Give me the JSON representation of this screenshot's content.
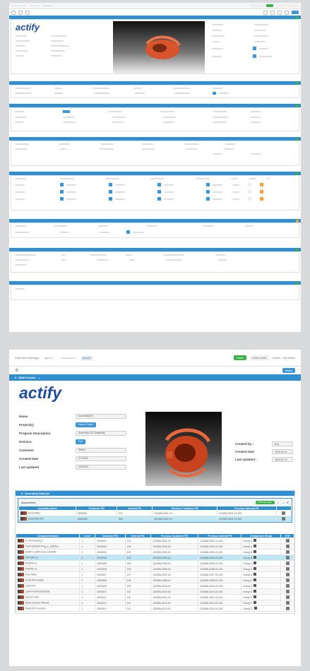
{
  "s1": {
    "tabs": [
      "",
      "",
      ""
    ],
    "header_pills": [
      "",
      "",
      ""
    ]
  },
  "s2": {
    "app_title": "Solid Item Manager",
    "tabs": [
      "Items",
      "Assembly List",
      "Draft"
    ],
    "top_right": {
      "green_btn": "Latest",
      "dropdown": "Select views",
      "user": "Admin · My tables"
    },
    "new_btn": "New",
    "banner_title": "SAM Version",
    "logo_text": "actify",
    "left_fields": [
      {
        "label": "Name",
        "value": "Assembly001"
      },
      {
        "label": "Project(s)",
        "value": "Demo Project",
        "style": "button"
      },
      {
        "label": "Program Description",
        "value": "Assembly 001 Assembly"
      },
      {
        "label": "Division",
        "value": "Part",
        "style": "button"
      },
      {
        "label": "Customer",
        "value": "Select"
      },
      {
        "label": "Created date",
        "value": "2/7/2023"
      },
      {
        "label": "Last updated",
        "value": "3/9/2023"
      }
    ],
    "right_fields": [
      {
        "label": "Created by :",
        "value": "Ken"
      },
      {
        "label": "Created date",
        "value": "2023-01-01"
      },
      {
        "label": "Last updated :",
        "value": "2023-01-01"
      }
    ],
    "assembly_panel_title": "Assembly Data (2)",
    "sub_title": "Assemblies",
    "sub_btn": "Add Assembly",
    "assembly_headers": [
      "Assembly Name",
      "Customer PN",
      "Internal PN",
      "Previous Customer PN",
      "Previous Internal PN",
      ""
    ],
    "assembly_rows": [
      {
        "name": "Assembly1",
        "cpn": "6500001",
        "ipn": "001",
        "pcpn": "123456-0001-22",
        "pipn": "123456-0001-22-001",
        "sel": false
      },
      {
        "name": "Assembly 001",
        "cpn": "6500002",
        "ipn": "002",
        "pcpn": "123456-0002-22",
        "pipn": "123456-0002-22-001",
        "sel": true
      }
    ],
    "component_headers": [
      "Component Name",
      "Level",
      "Customer PN",
      "Internal PN",
      "Previous Customer PN",
      "Previous Internal PN",
      "Component Group",
      "STR"
    ],
    "component_rows": [
      {
        "name": "E. Ink Sensing 1",
        "level": "1",
        "cpn": "2000001",
        "ipn": "101",
        "pcpn": "123456-2001-01",
        "pipn": "123456-2001-01-001",
        "group": "Group A",
        "sel": false
      },
      {
        "name": "Front (default Plug_1_2)(tube)",
        "level": "1",
        "cpn": "2000002",
        "ipn": "102",
        "pcpn": "123456-2002-01",
        "pipn": "123456-2002-01-001",
        "group": "Group A",
        "sel": false
      },
      {
        "name": "Shaft+1 (with Lever Default)",
        "level": "1",
        "cpn": "2000003",
        "ipn": "103",
        "pcpn": "123456-2003-01",
        "pipn": "123456-2003-01-001",
        "group": "Group B",
        "sel": false
      },
      {
        "name": "Flex (Pin 2)",
        "level": "1",
        "cpn": "2000004",
        "ipn": "104",
        "pcpn": "123456-2004-01",
        "pipn": "123456-2004-01-001",
        "group": "Group B",
        "sel": true
      },
      {
        "name": "Pin(PIN 1)",
        "level": "1",
        "cpn": "2000005",
        "ipn": "105",
        "pcpn": "123456-2005-01",
        "pipn": "123456-2005-01-001",
        "group": "Group C",
        "sel": false
      },
      {
        "name": "Pin(PIN 2)",
        "level": "1",
        "cpn": "2000006",
        "ipn": "106",
        "pcpn": "123456-2006-01",
        "pipn": "123456-2006-01-001",
        "group": "Group C",
        "sel": false
      },
      {
        "name": "Foot Slide",
        "level": "1",
        "cpn": "2000007",
        "ipn": "107",
        "pcpn": "123456-2007-01",
        "pipn": "123456-2007-01-001",
        "group": "Group D",
        "sel": false
      },
      {
        "name": "Front RH Diodes",
        "level": "1",
        "cpn": "2000008",
        "ipn": "108",
        "pcpn": "123456-2008-01",
        "pipn": "123456-2008-01-001",
        "group": "Group D",
        "sel": false
      },
      {
        "name": "Latch Pin",
        "level": "1",
        "cpn": "2000009",
        "ipn": "109",
        "pcpn": "123456-2009-01",
        "pipn": "123456-2009-01-001",
        "group": "Group E",
        "sel": false
      },
      {
        "name": "Latch Pusher(Default)",
        "level": "1",
        "cpn": "2000010",
        "ipn": "110",
        "pcpn": "123456-2010-01",
        "pipn": "123456-2010-01-001",
        "group": "Group E",
        "sel": false
      },
      {
        "name": "Spool Cover",
        "level": "1",
        "cpn": "2000011",
        "ipn": "111",
        "pcpn": "123456-2011-01",
        "pipn": "123456-2011-01-001",
        "group": "Group F",
        "sel": false
      },
      {
        "name": "Reed (Sensor Mount)",
        "level": "1",
        "cpn": "2000012",
        "ipn": "112",
        "pcpn": "123456-2012-01",
        "pipn": "123456-2012-01-001",
        "group": "Group F",
        "sel": false
      },
      {
        "name": "Reed (Pin Sensor)",
        "level": "1",
        "cpn": "2000013",
        "ipn": "113",
        "pcpn": "123456-2013-01",
        "pipn": "123456-2013-01-001",
        "group": "Group G",
        "sel": false
      }
    ],
    "colors": {
      "accent": "#2f8fd0",
      "green": "#3cb14a",
      "selected": "#bfe6f3",
      "logo": "#1f4f9a"
    }
  },
  "s1_logo": "actify"
}
